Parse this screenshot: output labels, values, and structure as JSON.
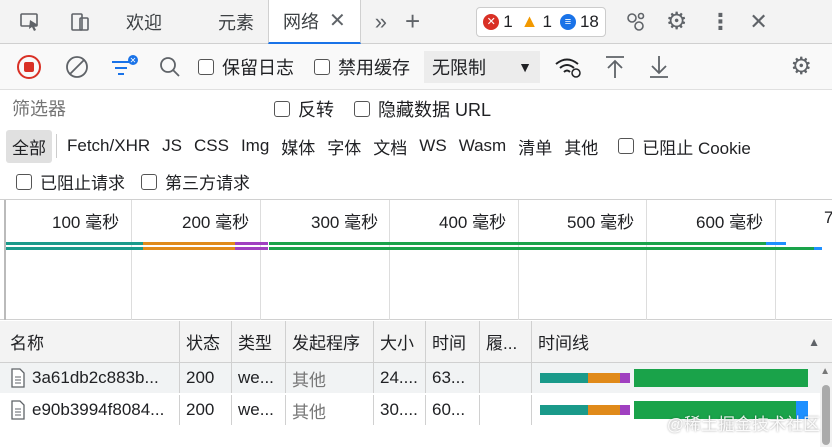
{
  "tabs": [
    {
      "label": "欢迎"
    },
    {
      "label": "元素"
    },
    {
      "label": "网络"
    }
  ],
  "badges": {
    "errors": "1",
    "warnings": "1",
    "info": "18"
  },
  "toolbar": {
    "preserve_log": "保留日志",
    "disable_cache": "禁用缓存",
    "throttle": "无限制"
  },
  "filter": {
    "placeholder": "筛选器",
    "invert": "反转",
    "hide_data_urls": "隐藏数据 URL"
  },
  "types": [
    "全部",
    "Fetch/XHR",
    "JS",
    "CSS",
    "Img",
    "媒体",
    "字体",
    "文档",
    "WS",
    "Wasm",
    "清单",
    "其他"
  ],
  "blocked_cookies": "已阻止 Cookie",
  "blocked_requests": "已阻止请求",
  "third_party": "第三方请求",
  "ticks": [
    "100 毫秒",
    "200 毫秒",
    "300 毫秒",
    "400 毫秒",
    "500 毫秒",
    "600 毫秒",
    "7"
  ],
  "columns": {
    "name": "名称",
    "status": "状态",
    "type": "类型",
    "initiator": "发起程序",
    "size": "大小",
    "time": "时间",
    "fulfilled": "履...",
    "waterfall": "时间线"
  },
  "rows": [
    {
      "name": "3a61db2c883b...",
      "status": "200",
      "type": "we...",
      "initiator": "其他",
      "size": "24....",
      "time": "63..."
    },
    {
      "name": "e90b3994f8084...",
      "status": "200",
      "type": "we...",
      "initiator": "其他",
      "size": "30....",
      "time": "60..."
    }
  ],
  "watermark": "@稀土掘金技术社区",
  "colors": {
    "accent": "#1a73e8",
    "error": "#d93025",
    "warning": "#f29900",
    "info": "#1a73e8",
    "teal": "#1a9a8a",
    "orange": "#e08a1a",
    "purple": "#a040c0",
    "green": "#1aa34a",
    "blue": "#1e90ff"
  }
}
